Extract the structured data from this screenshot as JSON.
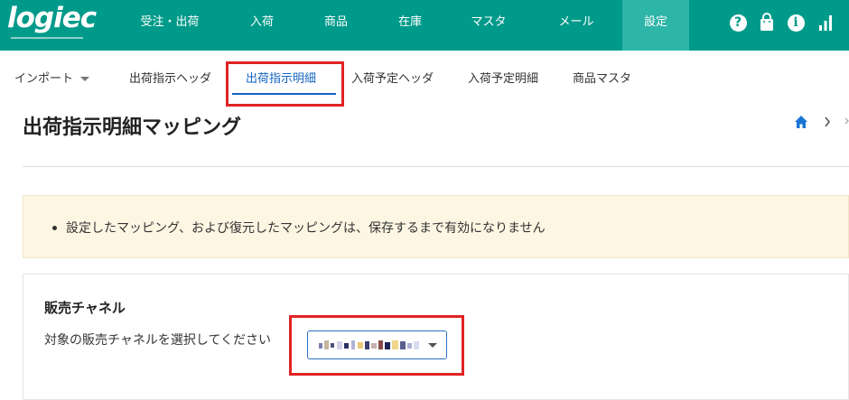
{
  "header": {
    "logo_text": "logiec",
    "nav": [
      {
        "label": "受注・出荷"
      },
      {
        "label": "入荷"
      },
      {
        "label": "商品"
      },
      {
        "label": "在庫"
      },
      {
        "label": "マスタ"
      },
      {
        "label": "メール"
      },
      {
        "label": "設定",
        "active": true
      }
    ],
    "icons": [
      "help-icon",
      "bag-icon",
      "info-icon",
      "signal-icon"
    ]
  },
  "subtabs": [
    {
      "label": "インポート",
      "dropdown": true
    },
    {
      "label": "出荷指示ヘッダ"
    },
    {
      "label": "出荷指示明細",
      "active": true
    },
    {
      "label": "入荷予定ヘッダ"
    },
    {
      "label": "入荷予定明細"
    },
    {
      "label": "商品マスタ"
    }
  ],
  "page": {
    "title": "出荷指示明細マッピング",
    "breadcrumb_icon": "home-icon"
  },
  "notice": {
    "items": [
      "設定したマッピング、および復元したマッピングは、保存するまで有効になりません"
    ]
  },
  "channel": {
    "heading": "販売チャネル",
    "description": "対象の販売チャネルを選択してください",
    "selected_value": "",
    "selected_value_obscured": true
  },
  "colors": {
    "header_bg": "#009a8a",
    "header_active": "#2db5a7",
    "accent": "#1565c0",
    "highlight_box": "#e02424",
    "notice_bg": "#fdf6e3"
  }
}
